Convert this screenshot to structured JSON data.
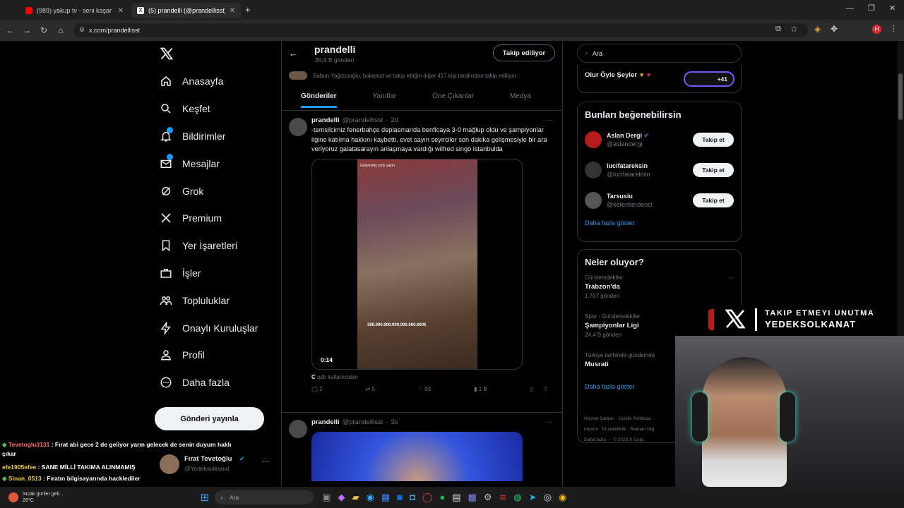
{
  "browser": {
    "tabs": [
      {
        "title": "(989) yakup tv - seni kaşar seni"
      },
      {
        "title": "(5) prandelli (@prandellisst) / X"
      }
    ],
    "url": "x.com/prandellisst"
  },
  "nav": {
    "items": [
      {
        "label": "Anasayfa",
        "icon": "home-icon"
      },
      {
        "label": "Keşfet",
        "icon": "search-icon"
      },
      {
        "label": "Bildirimler",
        "icon": "bell-icon"
      },
      {
        "label": "Mesajlar",
        "icon": "mail-icon"
      },
      {
        "label": "Grok",
        "icon": "grok-icon"
      },
      {
        "label": "Premium",
        "icon": "x-icon"
      },
      {
        "label": "Yer İşaretleri",
        "icon": "bookmark-icon"
      },
      {
        "label": "İşler",
        "icon": "briefcase-icon"
      },
      {
        "label": "Topluluklar",
        "icon": "people-icon"
      },
      {
        "label": "Onaylı Kuruluşlar",
        "icon": "bolt-icon"
      },
      {
        "label": "Profil",
        "icon": "user-icon"
      },
      {
        "label": "Daha fazla",
        "icon": "more-icon"
      }
    ],
    "post_button": "Gönderi yayınla"
  },
  "profile": {
    "name": "prandelli",
    "post_count": "26,9 B gönderi",
    "follow_state": "Takip ediliyor",
    "followers_note": "Sabun Yağızcıoğlu, bokanist ve takip ettiğin diğer 417 kişi tarafından takip ediliyor",
    "tabs": [
      "Gönderiler",
      "Yanıtlar",
      "Öne Çıkanlar",
      "Medya"
    ]
  },
  "tweets": [
    {
      "name": "prandelli",
      "handle": "@prandellisst",
      "time": "2d",
      "text": "-temsilcimiz fenerbahçe deplasmanda benficaya 3-0 mağlup oldu ve şampiyonlar ligine katılma hakkını kaybetti. evet sayın seyirciler son dakika gelişmesiyle bir ara veriyoruz galatasarayın anlaşmaya vardığı wilfred singo istanbulda",
      "video_time": "0:14",
      "video_overlay_top": "Gözlerimiş canlı yayın",
      "video_overlay_number": "300.000.000.000.000.000.000€",
      "attribution_letter": "C",
      "attribution_rest": " adlı kullanıcıdan",
      "replies": "2",
      "retweets": "5",
      "likes": "93",
      "views": "1 B"
    },
    {
      "name": "prandelli",
      "handle": "@prandellisst",
      "time": "3s"
    }
  ],
  "right": {
    "search_placeholder": "Ara",
    "community_title": "Olur Öyle Şeyler",
    "community_count": "+41",
    "suggest_title": "Bunları beğenebilirsin",
    "suggestions": [
      {
        "name": "Aslan Dergi",
        "handle": "@aslandergi",
        "button": "Takip et"
      },
      {
        "name": "lucifatareksin",
        "handle": "@lucifatareksin",
        "button": "Takip et"
      },
      {
        "name": "Tarsusiu",
        "handle": "@kefenlierdenci",
        "button": "Takip et"
      }
    ],
    "show_more": "Daha fazla göster",
    "trends_title": "Neler oluyor?",
    "trends": [
      {
        "context": "Gündemdekiler",
        "title": "Trabzon'da",
        "count": "1.707 gönderi"
      },
      {
        "context": "Spor · Gündemdekiler",
        "title": "Şampiyonlar Ligi",
        "count": "24,4 B gönderi"
      },
      {
        "context": "Türkiye tarihinde gündemde",
        "title": "Musrati",
        "count": ""
      }
    ],
    "trends_more": "Daha fazla göster",
    "footer": [
      "Hizmet Şartları",
      "Gizlilik Politikası",
      "Imprint",
      "Erişilebilirlik",
      "Reklam bilg",
      "Daha fazla ···",
      "© 2025 X Corp."
    ]
  },
  "overlay": {
    "line1": "TAKIP ETMEYI UNUTMA",
    "line2": "YEDEKSOLKANAT"
  },
  "chat": [
    {
      "user": "Tevetoglu3131",
      "msg": " : Fırat abi gece 2 de geliyor yarın gelecek de senin duyum haklı çıkar",
      "color": "#ff6b6b"
    },
    {
      "user": "efe1905efee",
      "msg": " : SANE MİLLİ TAKIMA ALINMAMIŞ",
      "color": "#f4d03f"
    },
    {
      "user": "Sinan_0513",
      "msg": " : Fıratın bilgisayarında hacklediler",
      "color": "#f4d03f"
    }
  ],
  "account": {
    "name": "Fırat Tevetoğlu",
    "handle": "@Yedeksolkanat"
  },
  "taskbar": {
    "weather_text": "Sıcak günler geli...",
    "temp": "28°C",
    "search": "Ara"
  }
}
